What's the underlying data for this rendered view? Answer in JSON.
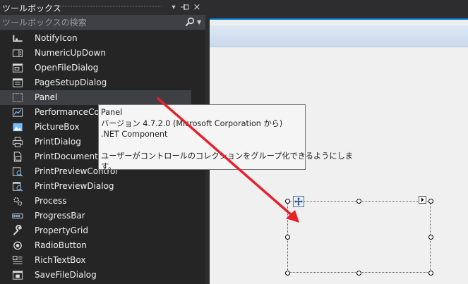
{
  "toolbox": {
    "title": "ツールボックス",
    "dropdown_glyph": "▾",
    "pin_glyph": "⊣",
    "close_glyph": "×",
    "search_placeholder": "ツールボックスの検索",
    "items": [
      {
        "label": "NotifyIcon",
        "icon": "notify-icon"
      },
      {
        "label": "NumericUpDown",
        "icon": "numeric-updown-icon"
      },
      {
        "label": "OpenFileDialog",
        "icon": "open-file-dialog-icon"
      },
      {
        "label": "PageSetupDialog",
        "icon": "page-setup-dialog-icon"
      },
      {
        "label": "Panel",
        "icon": "panel-icon",
        "selected": true
      },
      {
        "label": "PerformanceCounter",
        "icon": "performance-counter-icon"
      },
      {
        "label": "PictureBox",
        "icon": "picture-box-icon"
      },
      {
        "label": "PrintDialog",
        "icon": "print-dialog-icon"
      },
      {
        "label": "PrintDocument",
        "icon": "print-document-icon"
      },
      {
        "label": "PrintPreviewControl",
        "icon": "print-preview-control-icon"
      },
      {
        "label": "PrintPreviewDialog",
        "icon": "print-preview-dialog-icon"
      },
      {
        "label": "Process",
        "icon": "process-icon"
      },
      {
        "label": "ProgressBar",
        "icon": "progress-bar-icon"
      },
      {
        "label": "PropertyGrid",
        "icon": "property-grid-icon"
      },
      {
        "label": "RadioButton",
        "icon": "radio-button-icon"
      },
      {
        "label": "RichTextBox",
        "icon": "rich-text-box-icon"
      },
      {
        "label": "SaveFileDialog",
        "icon": "save-file-dialog-icon"
      }
    ]
  },
  "tooltip": {
    "name": "Panel",
    "version": "バージョン 4.7.2.0 (Microsoft Corporation から)",
    "kind": ".NET Component",
    "description_line1": "ユーザーがコントロールのコレクションをグループ化できるようにしま",
    "description_line2": "す。"
  },
  "colors": {
    "toolbox_bg": "#252526",
    "selected_item_bg": "#3f3f46",
    "accent": "#007acc",
    "annotation_arrow": "#e8202a",
    "tooltip_bg": "#f5f5f5",
    "icon_fg": "#dcdcdc",
    "icon_blue": "#75beff"
  }
}
